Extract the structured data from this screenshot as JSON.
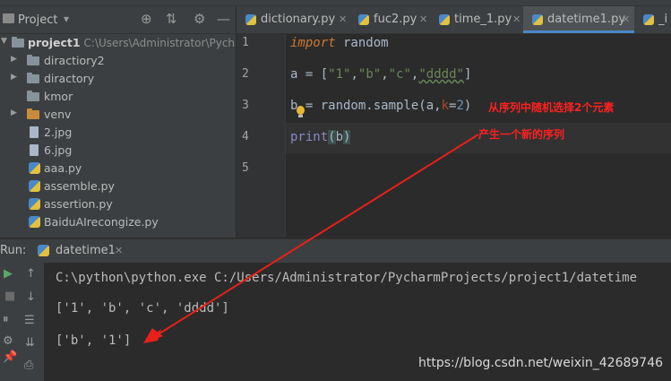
{
  "project_panel": {
    "title": "Project",
    "tree": [
      {
        "label": "project1",
        "path": "C:\\Users\\Administrator\\Pycharm"
      },
      {
        "label": "diractiory2"
      },
      {
        "label": "diractory"
      },
      {
        "label": "kmor"
      },
      {
        "label": "venv"
      },
      {
        "label": "2.jpg"
      },
      {
        "label": "6.jpg"
      },
      {
        "label": "aaa.py"
      },
      {
        "label": "assemble.py"
      },
      {
        "label": "assertion.py"
      },
      {
        "label": "BaiduAIrecongize.py"
      }
    ]
  },
  "tabs": [
    {
      "label": "dictionary.py"
    },
    {
      "label": "fuc2.py"
    },
    {
      "label": "time_1.py"
    },
    {
      "label": "datetime1.py",
      "active": true
    },
    {
      "label": "_i"
    }
  ],
  "editor": {
    "line_numbers": [
      "1",
      "2",
      "3",
      "4",
      "5"
    ],
    "lines": {
      "l1_kw": "import",
      "l1_rest": " random",
      "l2_a": "a = [",
      "l2_s1": "\"1\"",
      "l2_s2": "\"b\"",
      "l2_s3": "\"c\"",
      "l2_s4": "\"dddd\"",
      "l2_end": "]",
      "l3_a": "b = random.",
      "l3_fn": "sample",
      "l3_b": "(a,",
      "l3_param": "k",
      "l3_eq": "=",
      "l3_num": "2",
      "l3_end": ")",
      "l4_fn": "print",
      "l4_open": "(",
      "l4_var": "b",
      "l4_close": ")"
    },
    "annotation_1": "从序列中随机选择2个元素",
    "annotation_2": "产生一个新的序列"
  },
  "run": {
    "label": "Run:",
    "tab": "datetime1",
    "output": [
      "C:\\python\\python.exe C:/Users/Administrator/PycharmProjects/project1/datetime",
      "['1', 'b', 'c', 'dddd']",
      "['b', '1']"
    ]
  },
  "watermark": "https://blog.csdn.net/weixin_42689746",
  "colors": {
    "annotation": "#ff2020",
    "keyword": "#cc7832",
    "string": "#6a8759",
    "number": "#6897bb"
  }
}
